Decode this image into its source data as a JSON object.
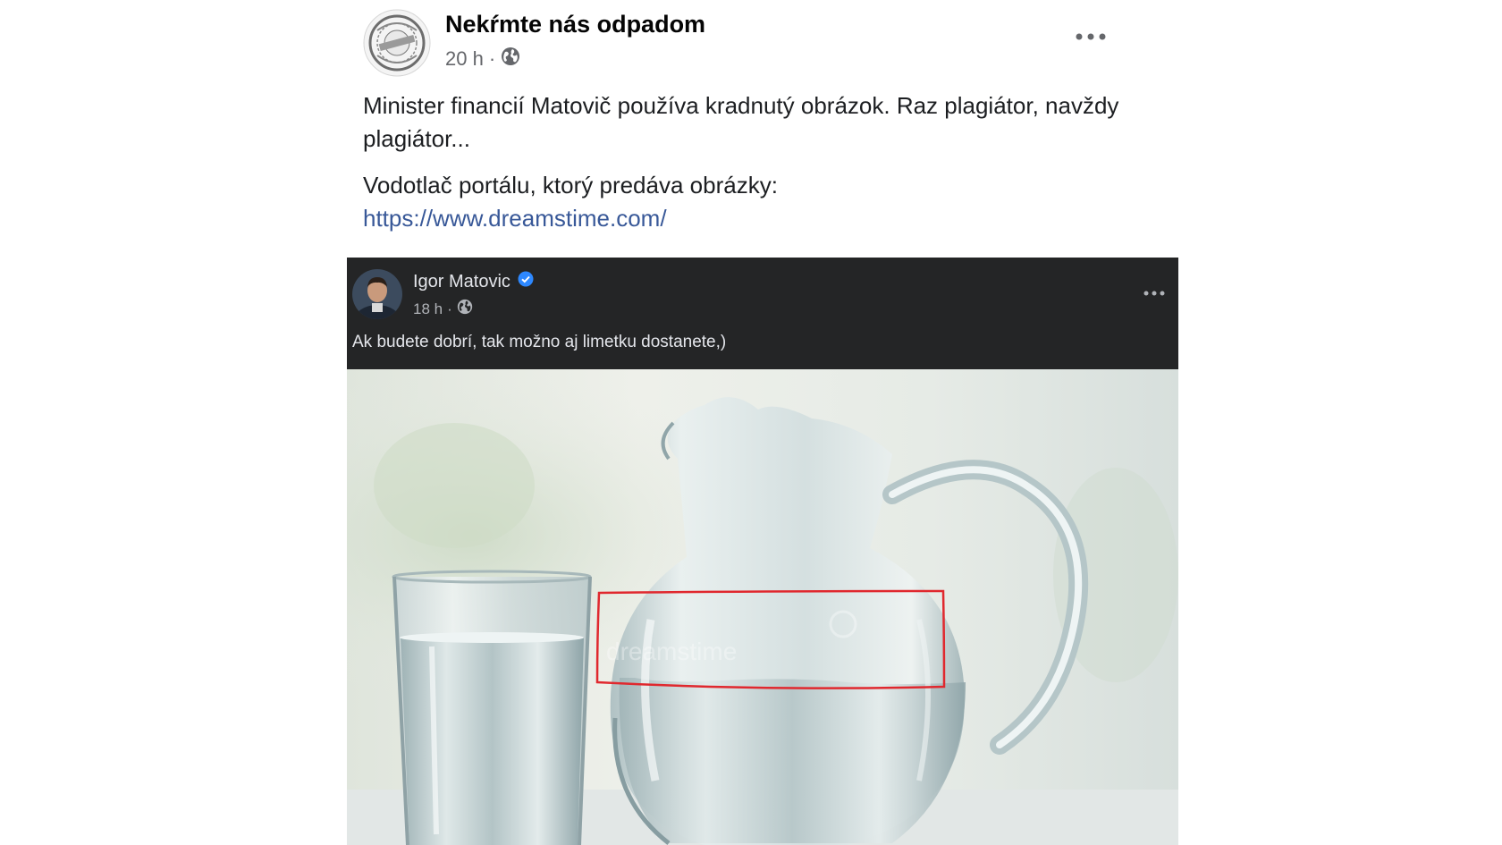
{
  "post": {
    "page_name": "Nekŕmte nás odpadom",
    "time": "20 h",
    "separator": "·",
    "audience_icon": "globe-icon",
    "more_icon": "more-options-icon",
    "text_line1": "Minister financií Matovič používa kradnutý obrázok. Raz plagiátor, navždy plagiátor...",
    "text_line2": "Vodotlač portálu, ktorý predáva obrázky:",
    "link": "https://www.dreamstime.com/"
  },
  "shared": {
    "author": "Igor Matovic",
    "verified_icon": "verified-badge-icon",
    "time": "18 h",
    "separator": "·",
    "audience_icon": "globe-icon",
    "more_icon": "more-options-icon",
    "text": "Ak budete dobrí, tak možno aj limetku dostanete,)"
  },
  "photo": {
    "description_icon": "water-pitcher-and-glass-photo",
    "highlight_color": "#e0282e"
  },
  "colors": {
    "link": "#385898",
    "dark_header": "#242526",
    "verified": "#2d88ff"
  }
}
